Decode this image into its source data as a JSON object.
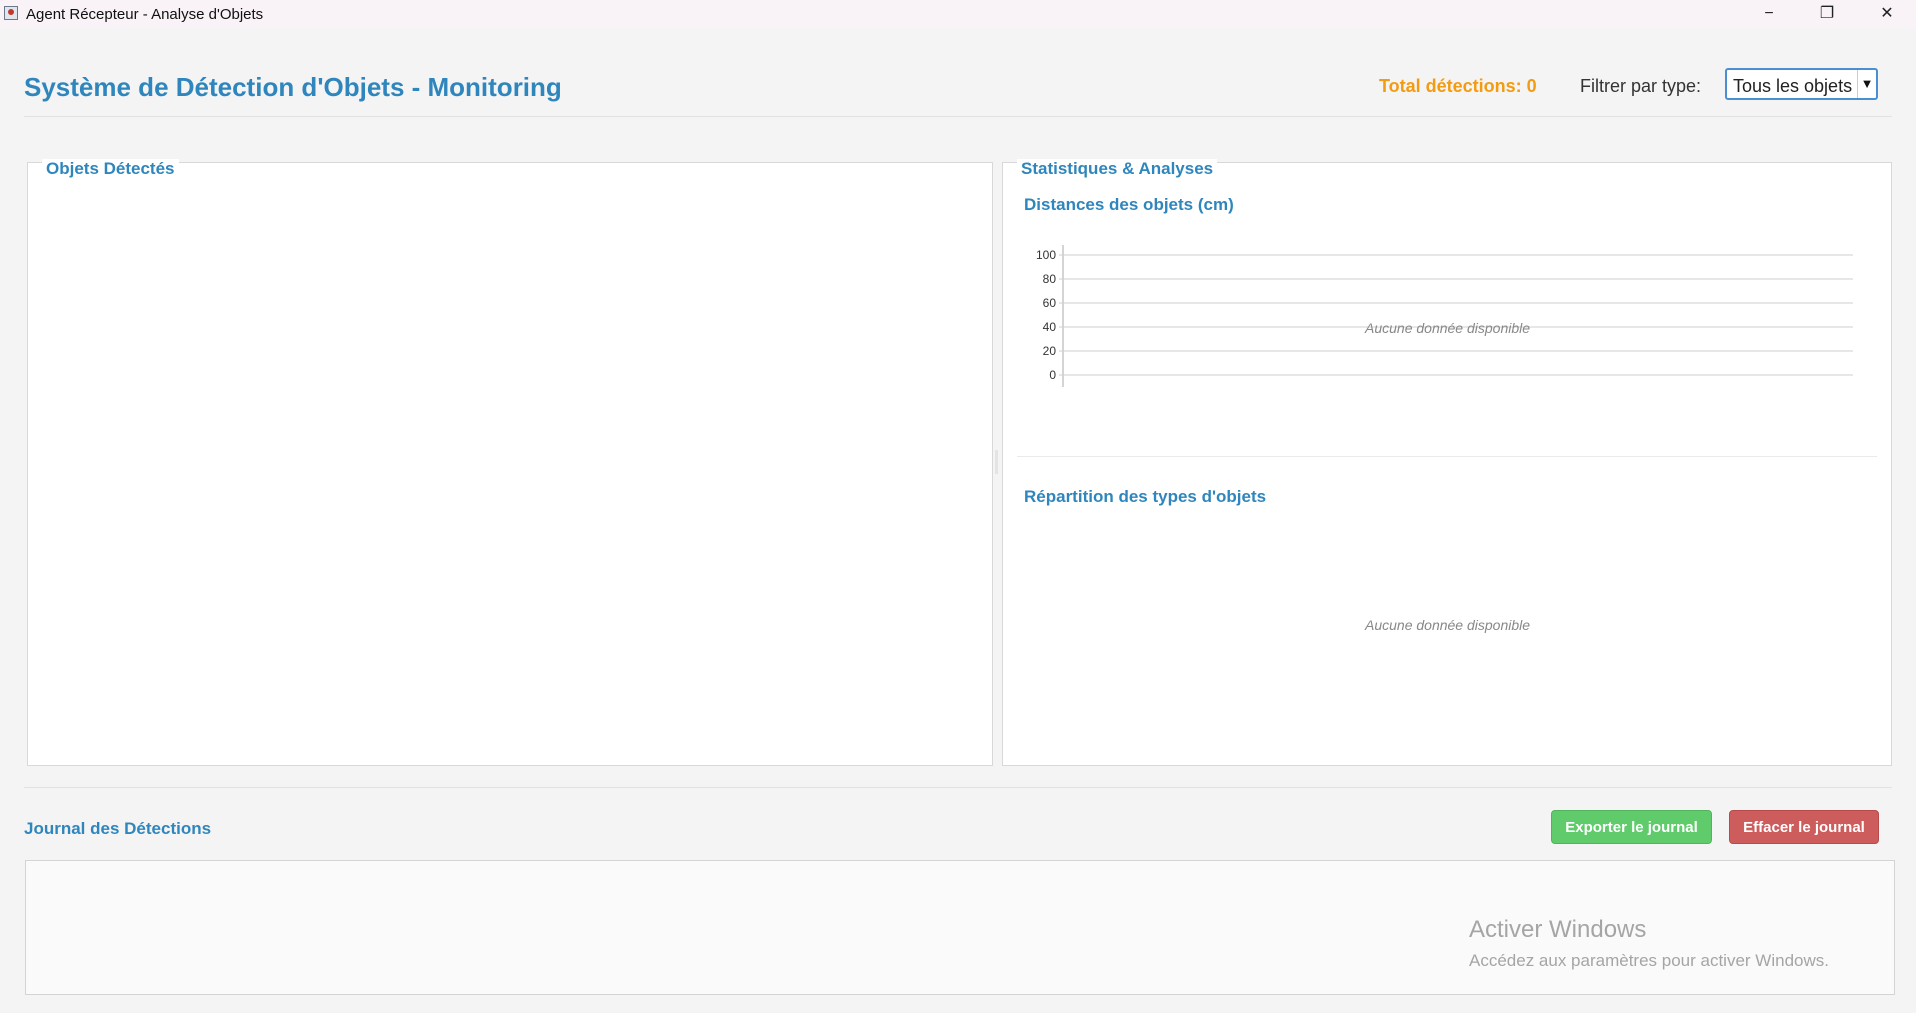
{
  "window": {
    "title": "Agent Récepteur - Analyse d'Objets",
    "controls": {
      "minimize": "−",
      "maximize": "❐",
      "close": "✕"
    }
  },
  "header": {
    "title": "Système de Détection d'Objets - Monitoring",
    "total_detections": "Total détections: 0",
    "filter_label": "Filtrer par type:",
    "filter_value": "Tous les objets"
  },
  "left_panel": {
    "title": "Objets Détectés"
  },
  "right_panel": {
    "title": "Statistiques & Analyses",
    "distance_chart_title": "Distances des objets (cm)",
    "types_chart_title": "Répartition des types d'objets",
    "empty_message": "Aucune donnée disponible"
  },
  "chart_data": [
    {
      "type": "bar",
      "title": "Distances des objets (cm)",
      "categories": [],
      "values": [],
      "ylim": [
        0,
        100
      ],
      "yticks": [
        "0",
        "20",
        "40",
        "60",
        "80",
        "100"
      ],
      "grid": true,
      "annotation": "Aucune donnée disponible"
    },
    {
      "type": "pie",
      "title": "Répartition des types d'objets",
      "categories": [],
      "values": [],
      "annotation": "Aucune donnée disponible"
    }
  ],
  "journal": {
    "title": "Journal des Détections",
    "export_label": "Exporter le journal",
    "clear_label": "Effacer le journal"
  },
  "watermark": {
    "title": "Activer Windows",
    "subtitle": "Accédez aux paramètres pour activer Windows."
  },
  "colors": {
    "accent": "#2f86bd",
    "total": "#f39c12",
    "export": "#5fcb6a",
    "clear": "#cd5c5c"
  }
}
